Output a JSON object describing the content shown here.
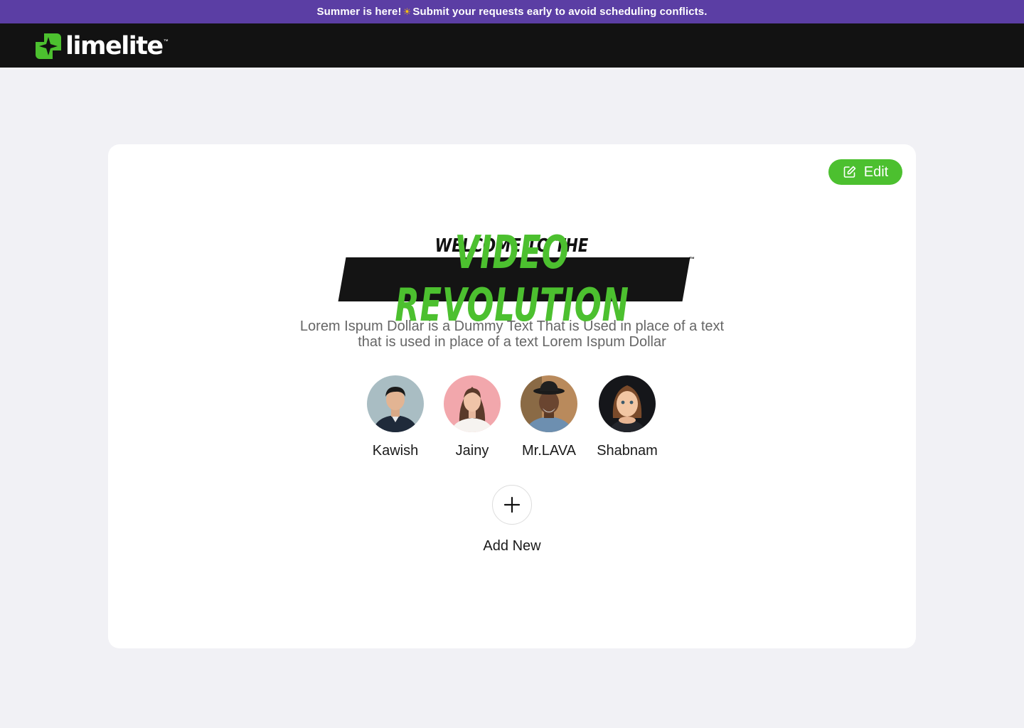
{
  "announcement": {
    "text_before": "Summer is here!",
    "emoji": "☀",
    "text_after": "Submit your requests early to avoid scheduling conflicts."
  },
  "header": {
    "logo_text": "limelite",
    "logo_tm": "™"
  },
  "card": {
    "edit_label": "Edit",
    "hero": {
      "welcome": "WELCOME TO THE",
      "title": "VIDEO REVOLUTION",
      "tm": "™",
      "description": "Lorem Ispum Dollar is a Dummy Text That is Used in place of a text that is used in place of a text Lorem Ispum Dollar"
    },
    "people": [
      {
        "name": "Kawish"
      },
      {
        "name": "Jainy"
      },
      {
        "name": "Mr.LAVA"
      },
      {
        "name": "Shabnam"
      }
    ],
    "add_new_label": "Add New"
  },
  "colors": {
    "announcement_bg": "#5b3ea4",
    "header_bg": "#121212",
    "brand_green": "#4cc02f",
    "page_bg": "#f1f1f5"
  }
}
